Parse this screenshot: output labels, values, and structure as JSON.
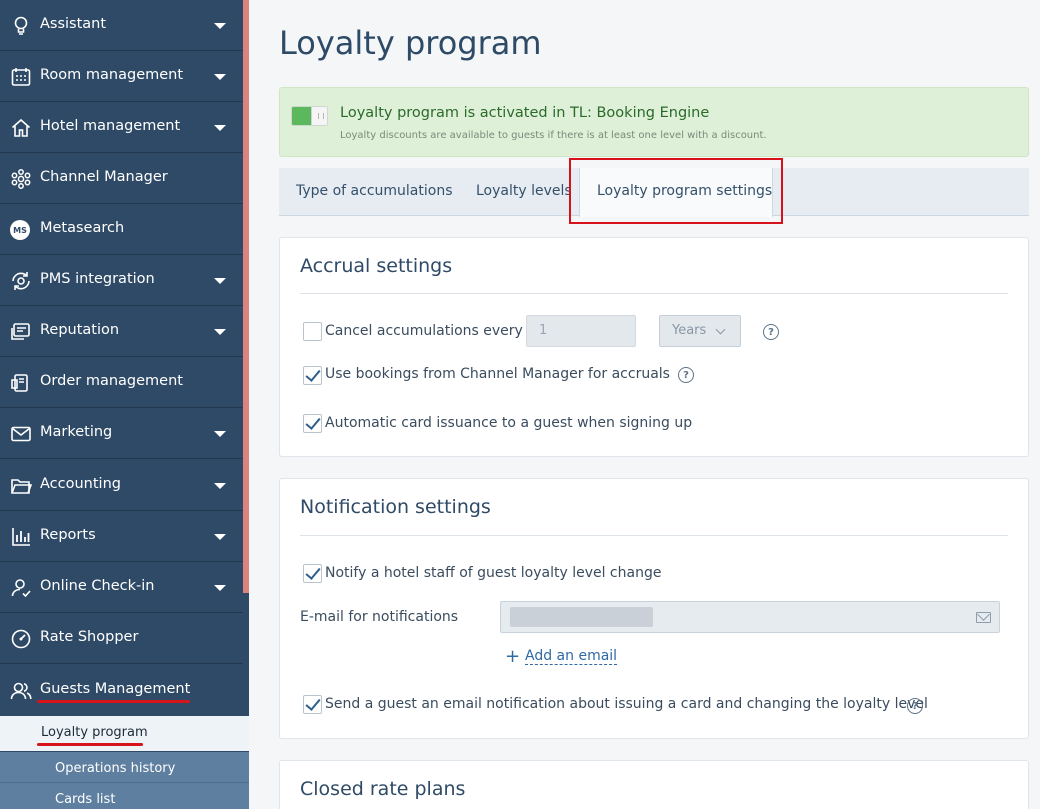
{
  "sidebar": {
    "items": [
      {
        "label": "Assistant",
        "icon": "lightbulb-icon",
        "has_caret": true
      },
      {
        "label": "Room management",
        "icon": "calendar-icon",
        "has_caret": true
      },
      {
        "label": "Hotel management",
        "icon": "house-icon",
        "has_caret": true
      },
      {
        "label": "Channel Manager",
        "icon": "network-icon",
        "has_caret": false
      },
      {
        "label": "Metasearch",
        "icon": "ms-badge-icon",
        "badge": "MS",
        "has_caret": false
      },
      {
        "label": "PMS integration",
        "icon": "sync-icon",
        "has_caret": true
      },
      {
        "label": "Reputation",
        "icon": "review-icon",
        "has_caret": true
      },
      {
        "label": "Order management",
        "icon": "order-icon",
        "has_caret": false
      },
      {
        "label": "Marketing",
        "icon": "envelope-icon",
        "has_caret": true
      },
      {
        "label": "Accounting",
        "icon": "folder-icon",
        "has_caret": true
      },
      {
        "label": "Reports",
        "icon": "bar-chart-icon",
        "has_caret": true
      },
      {
        "label": "Online Check-in",
        "icon": "checkin-user-icon",
        "has_caret": true
      },
      {
        "label": "Rate Shopper",
        "icon": "gauge-icon",
        "has_caret": false
      },
      {
        "label": "Guests Management",
        "icon": "users-icon",
        "has_caret": false
      }
    ],
    "sub_items": {
      "active": "Loyalty program",
      "others": [
        "Operations history",
        "Cards list"
      ]
    }
  },
  "main": {
    "title": "Loyalty program",
    "banner": {
      "title": "Loyalty program is activated in TL: Booking Engine",
      "note": "Loyalty discounts are available to guests if there is at least one level with a discount.",
      "toggle_on": true
    },
    "tabs": [
      "Type of accumulations",
      "Loyalty levels",
      "Loyalty program settings"
    ],
    "active_tab": "Loyalty program settings",
    "accrual": {
      "title": "Accrual settings",
      "cancel_label": "Cancel accumulations every",
      "cancel_checked": false,
      "cancel_value": "1",
      "period_value": "Years",
      "cm_label": "Use bookings from Channel Manager for accruals",
      "cm_checked": true,
      "auto_label": "Automatic card issuance to a guest when signing up",
      "auto_checked": true,
      "help_glyph": "?"
    },
    "notification": {
      "title": "Notification settings",
      "staff_label": "Notify a hotel staff of guest loyalty level change",
      "staff_checked": true,
      "email_label": "E-mail for notifications",
      "add_email": "Add an email",
      "add_plus": "+",
      "guest_label": "Send a guest an email notification about issuing a card and changing the loyalty level",
      "guest_checked": true,
      "help_glyph": "?"
    },
    "closed": {
      "title": "Closed rate plans"
    }
  },
  "colors": {
    "sidebar_bg": "#2f4a66",
    "sidebar_accent": "#d9857d",
    "highlight_red": "#d6141c",
    "banner_bg": "#dff0d8",
    "toggle_on": "#5cb85c",
    "link_blue": "#2f6aa5"
  }
}
